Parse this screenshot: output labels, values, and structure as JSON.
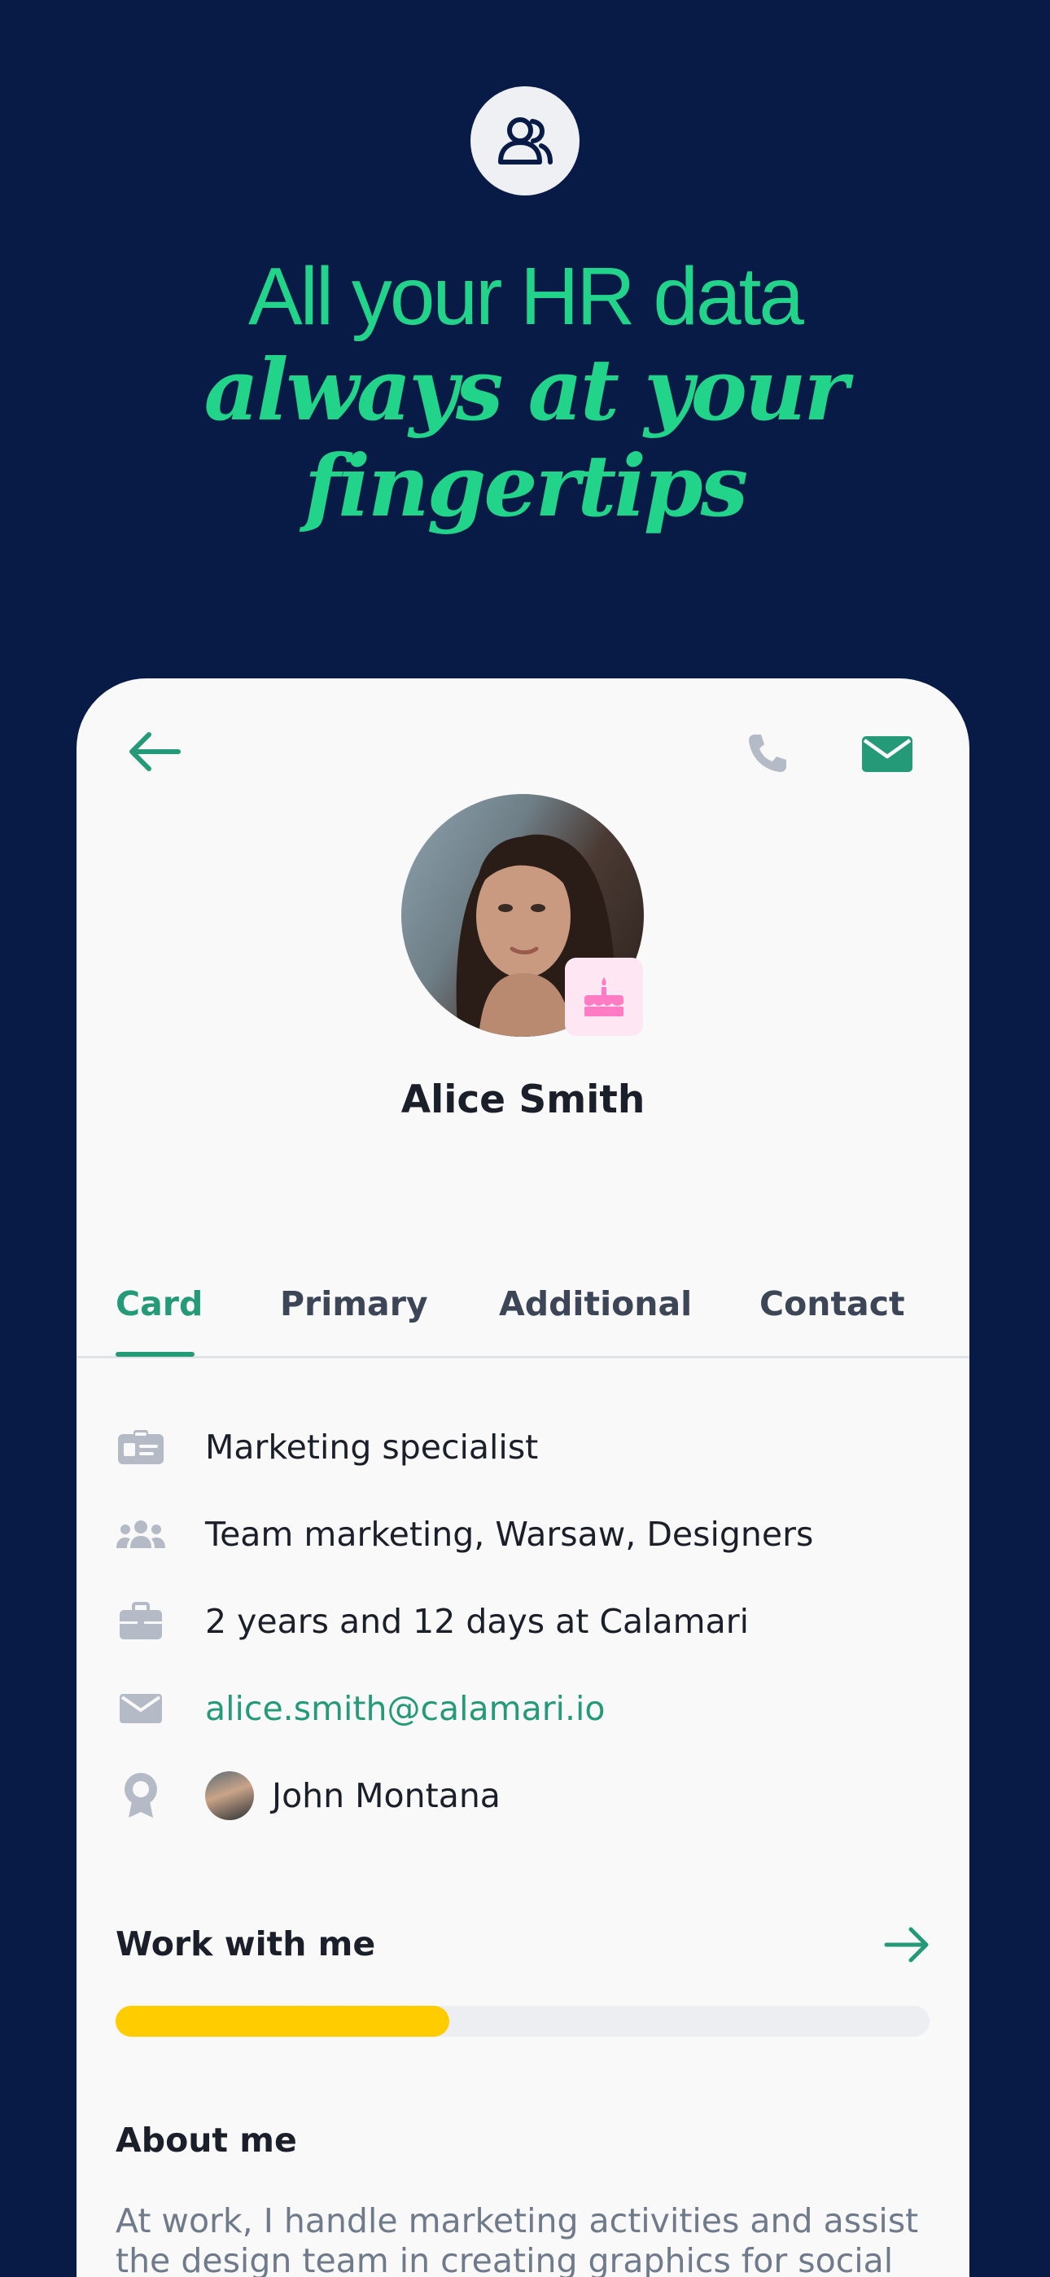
{
  "hero": {
    "icon": "users-icon",
    "headline_line1": "All your HR data",
    "headline_line2": "always at your fingertips"
  },
  "colors": {
    "background": "#081b46",
    "accent_green": "#249a78",
    "headline_green": "#22d48a",
    "progress_yellow": "#ffcc00",
    "birthday_pink": "#ff7cc5"
  },
  "profile": {
    "back_icon": "arrow-left-icon",
    "phone_icon": "phone-icon",
    "mail_icon": "mail-icon",
    "badge_icon": "birthday-cake-icon",
    "name": "Alice Smith"
  },
  "tabs": [
    {
      "label": "Card",
      "active": true
    },
    {
      "label": "Primary",
      "active": false
    },
    {
      "label": "Additional",
      "active": false
    },
    {
      "label": "Contact",
      "active": false
    }
  ],
  "details": {
    "position": "Marketing specialist",
    "teams": "Team marketing,  Warsaw,  Designers",
    "tenure": "2 years and 12 days at Calamari",
    "email": "alice.smith@calamari.io",
    "supervisor": "John Montana"
  },
  "work_with_me": {
    "title": "Work with me",
    "progress_fraction": 0.41
  },
  "about": {
    "title": "About me",
    "text": "At work, I handle marketing activities and assist the design team in creating graphics for social"
  }
}
